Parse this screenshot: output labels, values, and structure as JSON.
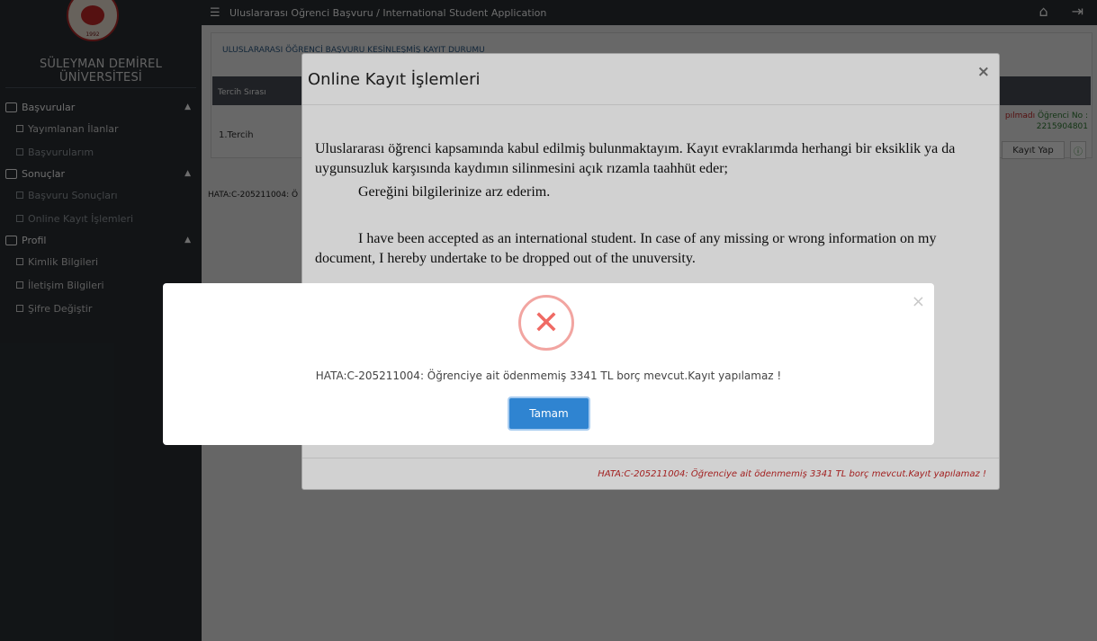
{
  "sidebar": {
    "logo_year": "1992",
    "university": "SÜLEYMAN DEMİREL ÜNİVERSİTESİ",
    "groups": [
      {
        "label": "Başvurular",
        "items": [
          "Yayımlanan İlanlar",
          "Başvurularım"
        ]
      },
      {
        "label": "Sonuçlar",
        "items": [
          "Başvuru Sonuçları",
          "Online Kayıt İşlemleri"
        ]
      },
      {
        "label": "Profil",
        "items": [
          "Kimlik Bilgileri",
          "İletişim Bilgileri",
          "Şifre Değiştir"
        ]
      }
    ]
  },
  "topbar": {
    "title": "Uluslararası Oğrenci Başvuru / International Student Application"
  },
  "background": {
    "panel_title": "ULUSLARARASI ÖĞRENCİ BAŞVURU KESİNLEŞMİŞ KAYIT DURUMU",
    "col_header": "Tercih Sırası",
    "row_label": "1.Tercih",
    "status_red": "pılmadı",
    "status_green": "Öğrenci No :",
    "student_no": "2215904801",
    "kayit_btn": "Kayıt Yap",
    "error_snippet": "HATA:C-205211004: Ö"
  },
  "modal": {
    "title": "Online Kayıt İşlemleri",
    "close": "×",
    "tr_text": "Uluslararası öğrenci kapsamında kabul edilmiş bulunmaktayım. Kayıt evraklarımda herhangi bir eksiklik ya da uygunsuzluk karşısında kaydımın silinmesini açık rızamla taahhüt eder;",
    "tr_closing": "Gereğini bilgilerinize arz ederim.",
    "en_text": "I have been accepted as an international student. In case of any missing or wrong information on my document, I hereby undertake to be dropped out of the unuversity.",
    "footer_error": "HATA:C-205211004: Öğrenciye ait ödenmemiş 3341 TL borç mevcut.Kayıt yapılamaz !"
  },
  "alert": {
    "close": "×",
    "icon": "error-x-icon",
    "message": "HATA:C-205211004: Öğrenciye ait ödenmemiş 3341 TL borç mevcut.Kayıt yapılamaz !",
    "button": "Tamam"
  }
}
